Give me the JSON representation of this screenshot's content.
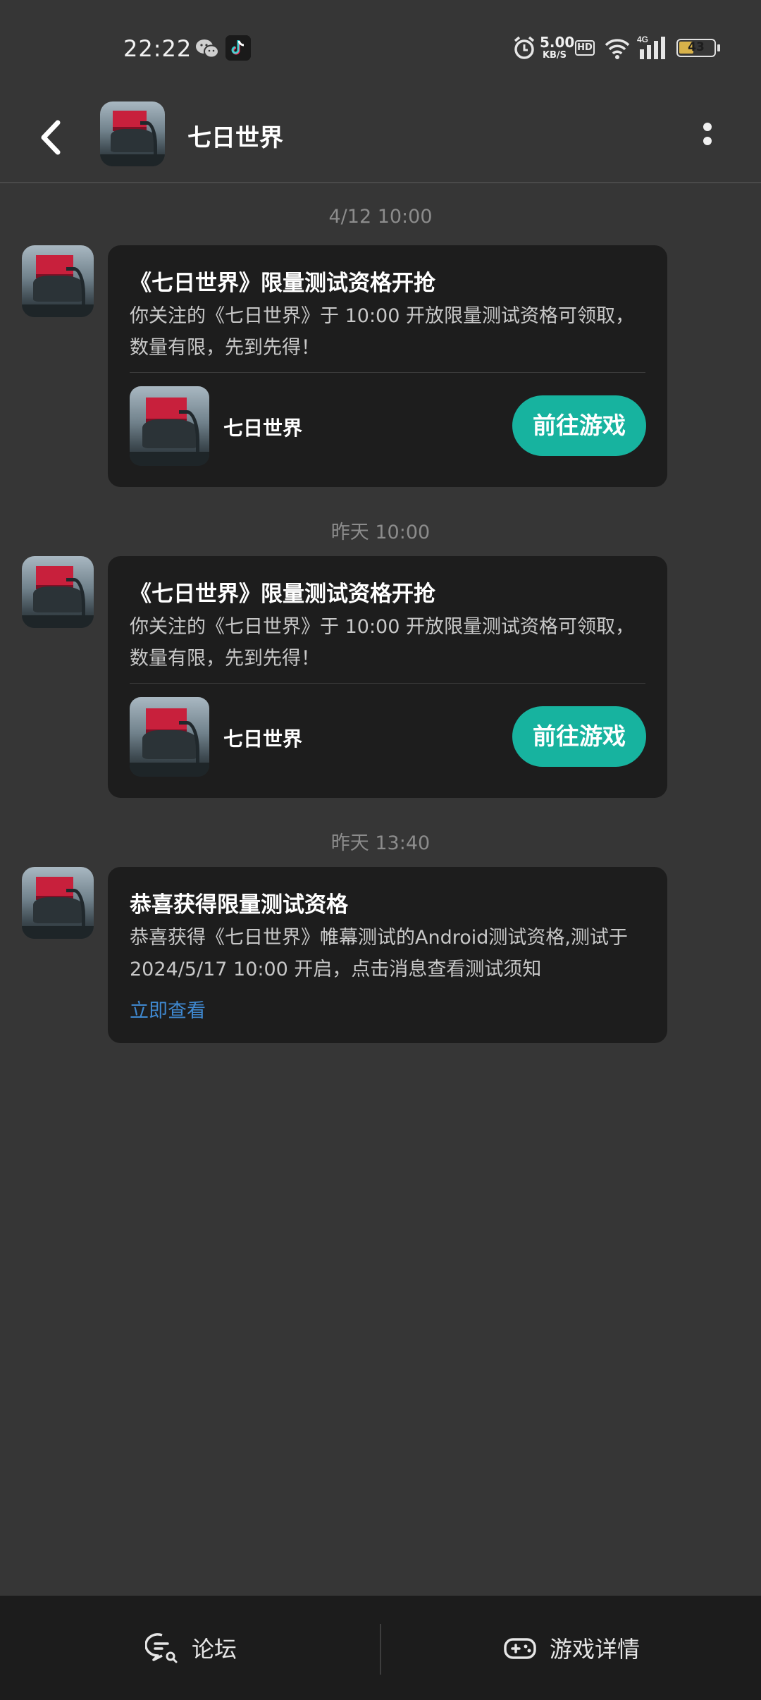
{
  "status_bar": {
    "time": "22:22",
    "net_speed_value": "5.00",
    "net_speed_unit": "KB/S",
    "hd_label": "HD",
    "signal_label": "4G",
    "battery": "43",
    "icons": [
      "wechat-icon",
      "tiktok-icon",
      "alarm-icon",
      "wifi-icon",
      "signal-icon",
      "battery-icon"
    ]
  },
  "header": {
    "title": "七日世界"
  },
  "messages": [
    {
      "time": "4/12  10:00",
      "title": "《七日世界》限量测试资格开抢",
      "body": "你关注的《七日世界》于 10:00 开放限量测试资格可领取，数量有限，先到先得！",
      "game_name": "七日世界",
      "button": "前往游戏"
    },
    {
      "time": "昨天  10:00",
      "title": "《七日世界》限量测试资格开抢",
      "body": "你关注的《七日世界》于 10:00 开放限量测试资格可领取，数量有限，先到先得！",
      "game_name": "七日世界",
      "button": "前往游戏"
    },
    {
      "time": "昨天  13:40",
      "title": "恭喜获得限量测试资格",
      "body": "恭喜获得《七日世界》帷幕测试的Android测试资格,测试于2024/5/17 10:00 开启，点击消息查看测试须知",
      "link": "立即查看"
    }
  ],
  "bottom_bar": {
    "forum": "论坛",
    "game_detail": "游戏详情"
  },
  "colors": {
    "background": "#363636",
    "card": "#1d1d1d",
    "accent": "#17b39f",
    "link": "#3f88cf"
  }
}
